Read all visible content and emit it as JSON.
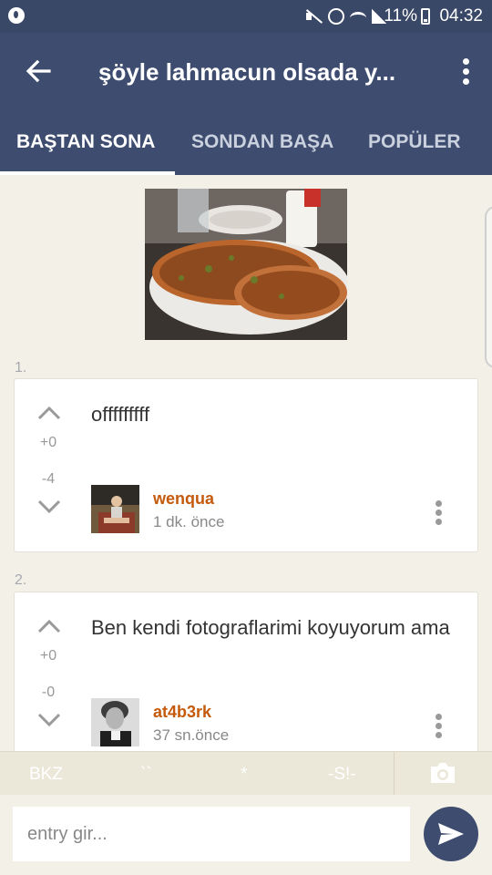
{
  "status_bar": {
    "battery": "11%",
    "time": "04:32"
  },
  "app_bar": {
    "title": "şöyle lahmacun olsada y..."
  },
  "tabs": [
    {
      "label": "BAŞTAN SONA",
      "active": true
    },
    {
      "label": "SONDAN BAŞA",
      "active": false
    },
    {
      "label": "POPÜLER",
      "active": false
    }
  ],
  "entries": [
    {
      "number": "1.",
      "text": "offfffffff",
      "upvotes": "+0",
      "downvotes": "-4",
      "author": "wenqua",
      "time": "1 dk. önce"
    },
    {
      "number": "2.",
      "text": "Ben kendi fotograflarimi koyuyorum ama",
      "upvotes": "+0",
      "downvotes": "-0",
      "author": "at4b3rk",
      "time": "37 sn.önce"
    }
  ],
  "toolbar": {
    "bkz": "BKZ",
    "backtick": "``",
    "star": "*",
    "spoiler": "-S!-"
  },
  "input": {
    "placeholder": "entry gir..."
  },
  "colors": {
    "primary": "#3e4c6f",
    "author": "#c45a0c",
    "background": "#f3f1e7"
  }
}
